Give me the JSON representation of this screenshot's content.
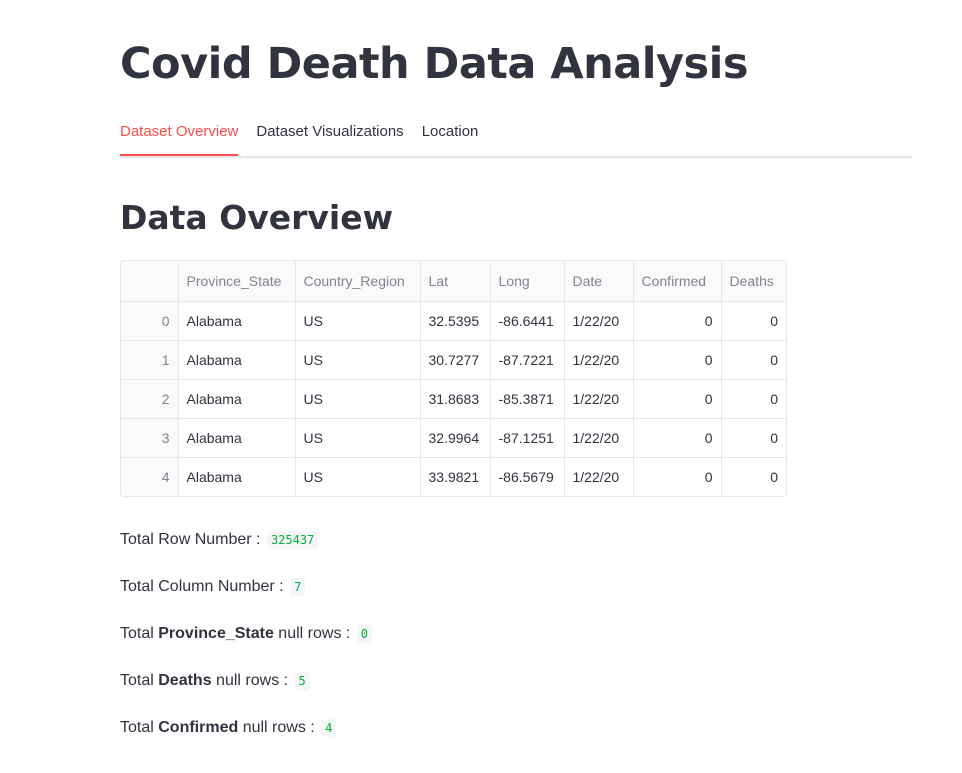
{
  "app": {
    "title": "Covid Death Data Analysis"
  },
  "tabs": [
    {
      "label": "Dataset Overview",
      "active": true
    },
    {
      "label": "Dataset Visualizations",
      "active": false
    },
    {
      "label": "Location",
      "active": false
    }
  ],
  "section": {
    "heading": "Data Overview"
  },
  "table": {
    "columns": [
      "",
      "Province_State",
      "Country_Region",
      "Lat",
      "Long",
      "Date",
      "Confirmed",
      "Deaths"
    ],
    "rows": [
      [
        "0",
        "Alabama",
        "US",
        "32.5395",
        "-86.6441",
        "1/22/20",
        "0",
        "0"
      ],
      [
        "1",
        "Alabama",
        "US",
        "30.7277",
        "-87.7221",
        "1/22/20",
        "0",
        "0"
      ],
      [
        "2",
        "Alabama",
        "US",
        "31.8683",
        "-85.3871",
        "1/22/20",
        "0",
        "0"
      ],
      [
        "3",
        "Alabama",
        "US",
        "32.9964",
        "-87.1251",
        "1/22/20",
        "0",
        "0"
      ],
      [
        "4",
        "Alabama",
        "US",
        "33.9821",
        "-86.5679",
        "1/22/20",
        "0",
        "0"
      ]
    ]
  },
  "stats": {
    "row_number": {
      "prefix": "Total Row Number : ",
      "value": "325437"
    },
    "column_number": {
      "prefix": "Total Column Number : ",
      "value": "7"
    },
    "province_null": {
      "prefix": "Total ",
      "bold": "Province_State",
      "suffix": " null rows : ",
      "value": "0"
    },
    "deaths_null": {
      "prefix": "Total ",
      "bold": "Deaths",
      "suffix": " null rows : ",
      "value": "5"
    },
    "confirmed_null": {
      "prefix": "Total ",
      "bold": "Confirmed",
      "suffix": " null rows : ",
      "value": "4"
    }
  },
  "colors": {
    "accent": "#ff4b4b",
    "text": "#31333f",
    "code_text": "#09ab3b"
  }
}
